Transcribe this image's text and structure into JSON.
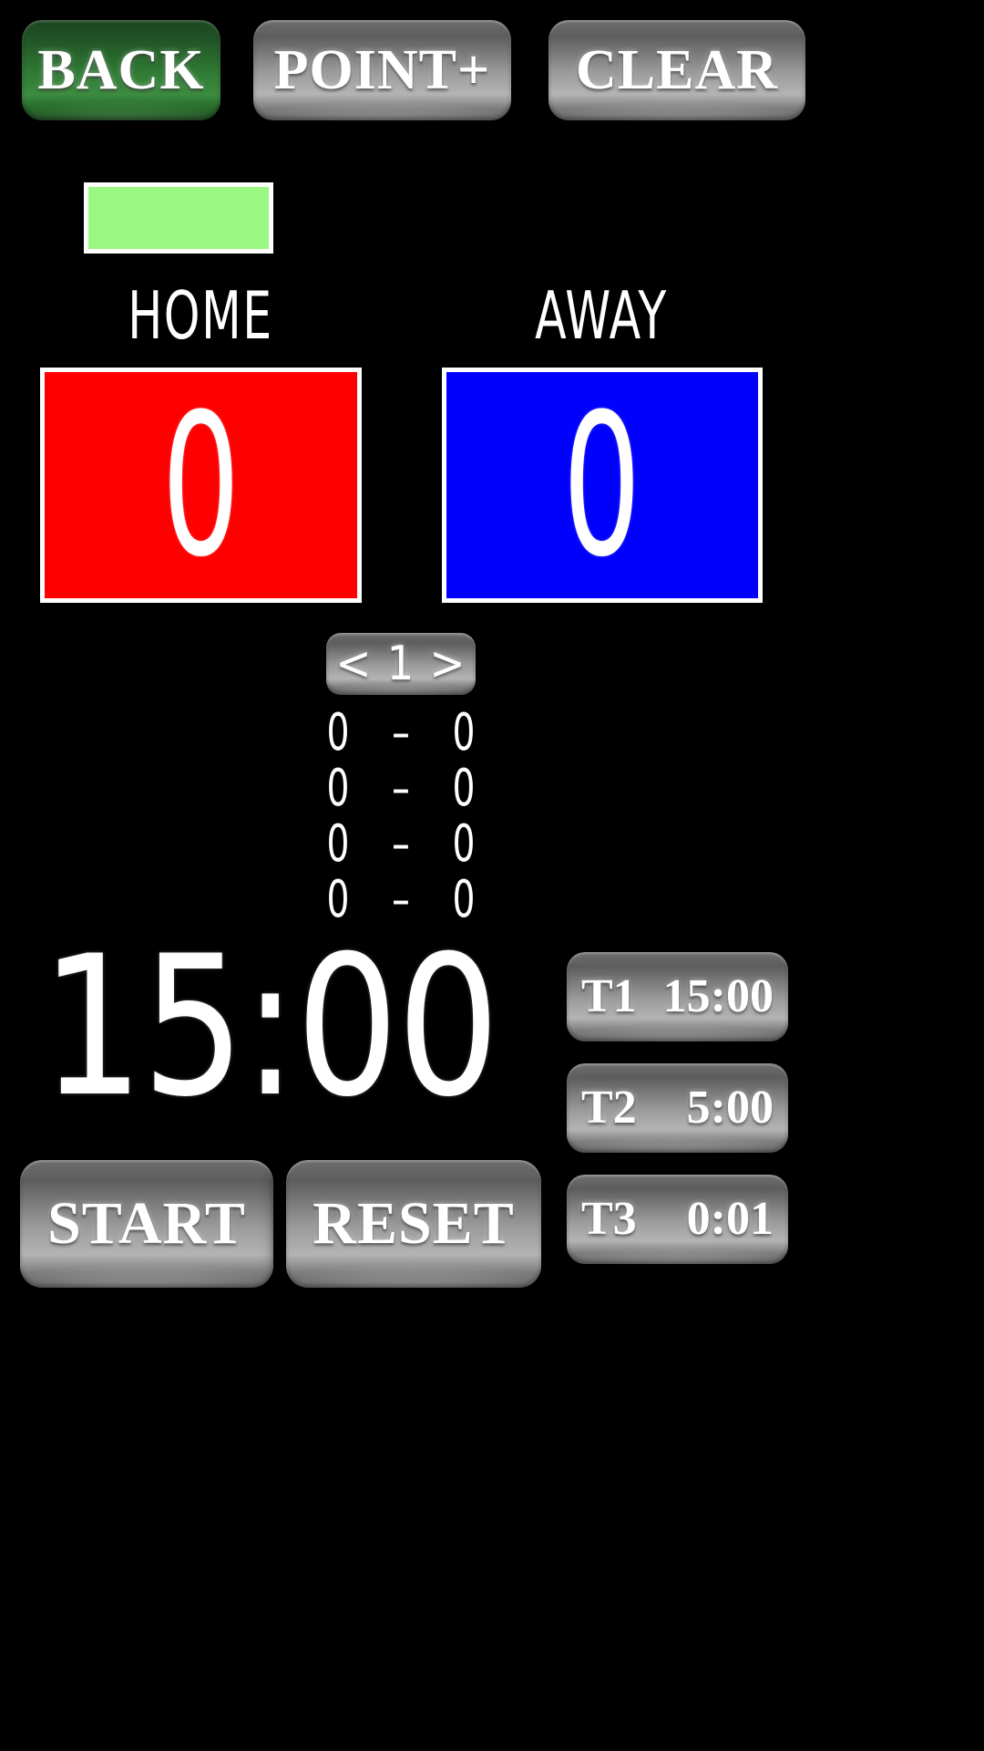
{
  "app": {
    "title": "Scoreboard",
    "background_color": "#000000"
  },
  "toolbar": {
    "back_label": "BACK",
    "point_label": "POINT+",
    "clear_label": "CLEAR",
    "back_color": "#2f7a34",
    "button_color": "#9a9a9a"
  },
  "indicator": {
    "color": "#99f983",
    "border_color": "#ffffff",
    "visible": true
  },
  "teams": {
    "home": {
      "label": "HOME",
      "score": "0",
      "box_color": "#fe0000"
    },
    "away": {
      "label": "AWAY",
      "score": "0",
      "box_color": "#0000fd"
    }
  },
  "period": {
    "prev_label": "<",
    "current": "1",
    "next_label": ">",
    "rows": [
      {
        "home": "0",
        "dash": "–",
        "away": "0"
      },
      {
        "home": "0",
        "dash": "–",
        "away": "0"
      },
      {
        "home": "0",
        "dash": "–",
        "away": "0"
      },
      {
        "home": "0",
        "dash": "–",
        "away": "0"
      }
    ]
  },
  "clock": {
    "display": "15:00",
    "start_label": "START",
    "reset_label": "RESET"
  },
  "presets": [
    {
      "name": "T1",
      "time": "15:00"
    },
    {
      "name": "T2",
      "time": "5:00"
    },
    {
      "name": "T3",
      "time": "0:01"
    }
  ]
}
